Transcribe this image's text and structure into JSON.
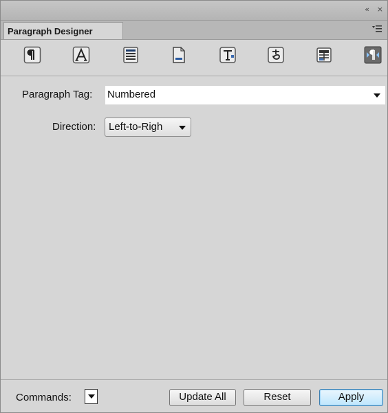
{
  "titlebar": {
    "collapse_glyph": "«",
    "close_glyph": "×"
  },
  "tabs": [
    {
      "label": "Paragraph Designer",
      "active": true
    }
  ],
  "toolbar": {
    "icons": [
      "pilcrow-icon",
      "character-a-icon",
      "text-lines-icon",
      "page-number-icon",
      "text-frame-t-icon",
      "asian-character-icon",
      "table-cell-icon",
      "paragraph-direction-icon"
    ],
    "selected_index": 7
  },
  "form": {
    "paragraph_tag_label": "Paragraph Tag:",
    "paragraph_tag_value": "Numbered",
    "direction_label": "Direction:",
    "direction_value": "Left-to-Righ"
  },
  "footer": {
    "commands_label": "Commands:",
    "update_all_label": "Update All",
    "reset_label": "Reset",
    "apply_label": "Apply"
  },
  "colors": {
    "panel_bg": "#d6d6d6",
    "primary_button_border": "#3c7fb1",
    "selected_tool_bg": "#6b6b6b"
  }
}
